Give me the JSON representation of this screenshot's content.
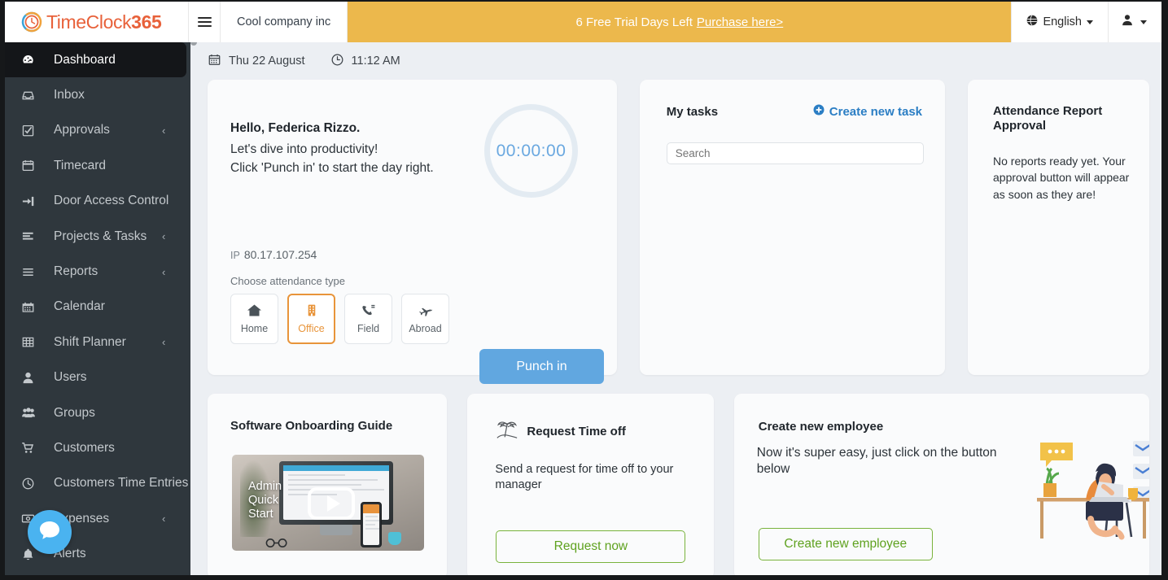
{
  "header": {
    "logo_text_regular": "TimeClock",
    "logo_text_bold": "365",
    "logo_icon": "clock-circle-logo",
    "menu_toggle_icon": "hamburger-icon",
    "company_name": "Cool company inc",
    "trial_text": "6 Free Trial Days Left",
    "trial_link": "Purchase here>",
    "language_icon": "globe-icon",
    "language": "English",
    "user_icon": "user-icon"
  },
  "sidebar": {
    "items": [
      {
        "label": "Dashboard",
        "icon": "dashboard-gauge-icon",
        "active": true,
        "chevron": ""
      },
      {
        "label": "Inbox",
        "icon": "inbox-icon",
        "active": false,
        "chevron": ""
      },
      {
        "label": "Approvals",
        "icon": "check-square-icon",
        "active": false,
        "chevron": "‹"
      },
      {
        "label": "Timecard",
        "icon": "calendar-icon",
        "active": false,
        "chevron": ""
      },
      {
        "label": "Door Access Control",
        "icon": "sign-in-door-icon",
        "active": false,
        "chevron": ""
      },
      {
        "label": "Projects & Tasks",
        "icon": "tasks-list-icon",
        "active": false,
        "chevron": "‹"
      },
      {
        "label": "Reports",
        "icon": "bars-icon",
        "active": false,
        "chevron": "‹"
      },
      {
        "label": "Calendar",
        "icon": "calendar-grid-icon",
        "active": false,
        "chevron": ""
      },
      {
        "label": "Shift Planner",
        "icon": "table-icon",
        "active": false,
        "chevron": "‹"
      },
      {
        "label": "Users",
        "icon": "user-icon",
        "active": false,
        "chevron": ""
      },
      {
        "label": "Groups",
        "icon": "users-group-icon",
        "active": false,
        "chevron": ""
      },
      {
        "label": "Customers",
        "icon": "shopping-cart-icon",
        "active": false,
        "chevron": ""
      },
      {
        "label": "Customers Time Entries",
        "icon": "clock-icon",
        "active": false,
        "chevron": ""
      },
      {
        "label": "Expenses",
        "icon": "money-bill-icon",
        "active": false,
        "chevron": "‹"
      },
      {
        "label": "Alerts",
        "icon": "bell-icon",
        "active": false,
        "chevron": ""
      }
    ]
  },
  "datebar": {
    "calendar_icon": "calendar-icon",
    "date": "Thu 22 August",
    "clock_icon": "clock-icon",
    "time": "11:12 AM"
  },
  "punch_card": {
    "greeting": "Hello, Federica Rizzo.",
    "line2": "Let's dive into productivity!",
    "line3": "Click 'Punch in' to start the day right.",
    "timer": "00:00:00",
    "ip_label": "IP",
    "ip_value": "80.17.107.254",
    "attendance_label": "Choose attendance type",
    "attendance_types": [
      {
        "label": "Home",
        "icon": "home-icon",
        "selected": false
      },
      {
        "label": "Office",
        "icon": "building-icon",
        "selected": true
      },
      {
        "label": "Field",
        "icon": "phone-field-icon",
        "selected": false
      },
      {
        "label": "Abroad",
        "icon": "plane-icon",
        "selected": false
      }
    ],
    "punch_button": "Punch in",
    "accent_selected": "#e8943a",
    "accent_punch": "#61a7e0"
  },
  "tasks_card": {
    "title": "My tasks",
    "create_icon": "plus-circle-icon",
    "create_label": "Create new task",
    "search_value": "",
    "search_placeholder": "Search",
    "accent": "#2b7ec4"
  },
  "approval_card": {
    "title": "Attendance Report Approval",
    "body": "No reports ready yet. Your approval button will appear as soon as they are!"
  },
  "onboarding_card": {
    "title": "Software Onboarding Guide",
    "video_title": "Admin\nQuick\nStart",
    "video_title_l1": "Admin",
    "video_title_l2": "Quick",
    "video_title_l3": "Start",
    "play_icon": "play-button-icon"
  },
  "timeoff_card": {
    "icon": "palm-tree-icon",
    "title": "Request Time off",
    "body": "Send a request for time off to your manager",
    "button": "Request now",
    "accent": "#79b33c"
  },
  "employee_card": {
    "title": "Create new employee",
    "body": "Now it's super easy, just click on the button below",
    "button": "Create new employee",
    "illustration": "woman-at-desk-with-laptop-illustration",
    "accent": "#79b33c"
  },
  "chat_widget": {
    "icon": "chat-bubble-icon",
    "color": "#4ab3f0"
  }
}
